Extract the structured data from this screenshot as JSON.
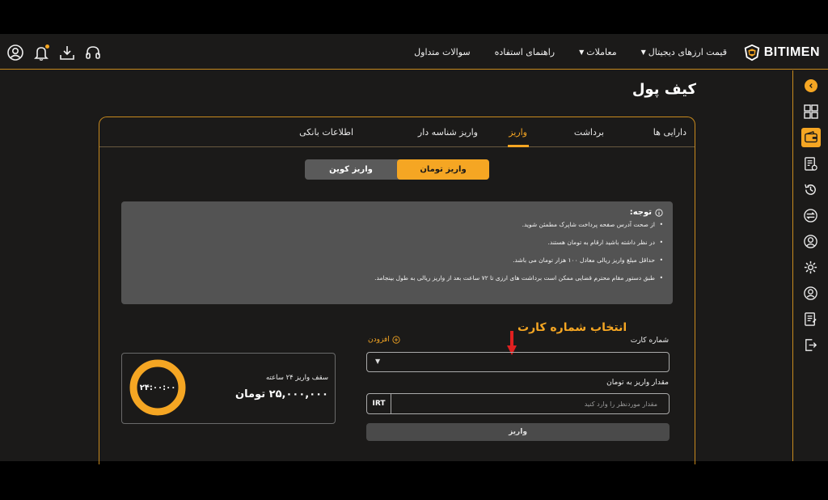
{
  "brand": {
    "name": "BITIMEN"
  },
  "nav": {
    "items": [
      {
        "label": "قیمت ارزهای دیجیتال",
        "has_dropdown": true
      },
      {
        "label": "معاملات",
        "has_dropdown": true
      },
      {
        "label": "راهنمای استفاده",
        "has_dropdown": false
      },
      {
        "label": "سوالات متداول",
        "has_dropdown": false
      }
    ]
  },
  "top_icons": [
    "support-icon",
    "download-icon",
    "notification-icon",
    "user-icon"
  ],
  "sidebar_icons": [
    "collapse-icon",
    "dashboard-icon",
    "wallet-icon",
    "orders-icon",
    "history-icon",
    "exchange-icon",
    "profile-icon",
    "settings-icon",
    "account-icon",
    "document-icon",
    "logout-icon"
  ],
  "page": {
    "title": "کیف پول"
  },
  "tabs": [
    {
      "label": "دارایی ها",
      "active": false
    },
    {
      "label": "برداشت",
      "active": false
    },
    {
      "label": "واریز",
      "active": true
    },
    {
      "label": "واریز شناسه دار",
      "active": false
    },
    {
      "label": "اطلاعات بانکی",
      "active": false
    }
  ],
  "switch": {
    "toman": "واریز تومان",
    "coin": "واریز کوین",
    "active": "toman"
  },
  "notice": {
    "title": "توجه:",
    "items": [
      "از صحت آدرس صفحه پرداخت شاپرک مطمئن شوید.",
      "در نظر داشته باشید ارقام به تومان هستند.",
      "حداقل مبلغ واریز ریالی معادل ۱۰۰ هزار تومان می باشد.",
      "طبق دستور مقام محترم قضایی ممکن است برداشت های ارزی تا ۷۲ ساعت بعد از واریز ریالی به طول بینجامد."
    ]
  },
  "annotation": {
    "text": "انتخاب شماره کارت"
  },
  "form": {
    "card_label": "شماره کارت",
    "add_label": "افزودن",
    "amount_label": "مقدار واریز به تومان",
    "currency": "IRT",
    "amount_placeholder": "مقدار موردنظر را وارد کنید",
    "submit": "واریز"
  },
  "limit": {
    "title": "سقف واریز ۲۴ ساعته",
    "value": "۲۵,۰۰۰,۰۰۰ تومان",
    "timer": "۲۴:۰۰:۰۰"
  },
  "colors": {
    "accent": "#f5a623",
    "background": "#1b1a19",
    "notice_bg": "#535353"
  }
}
